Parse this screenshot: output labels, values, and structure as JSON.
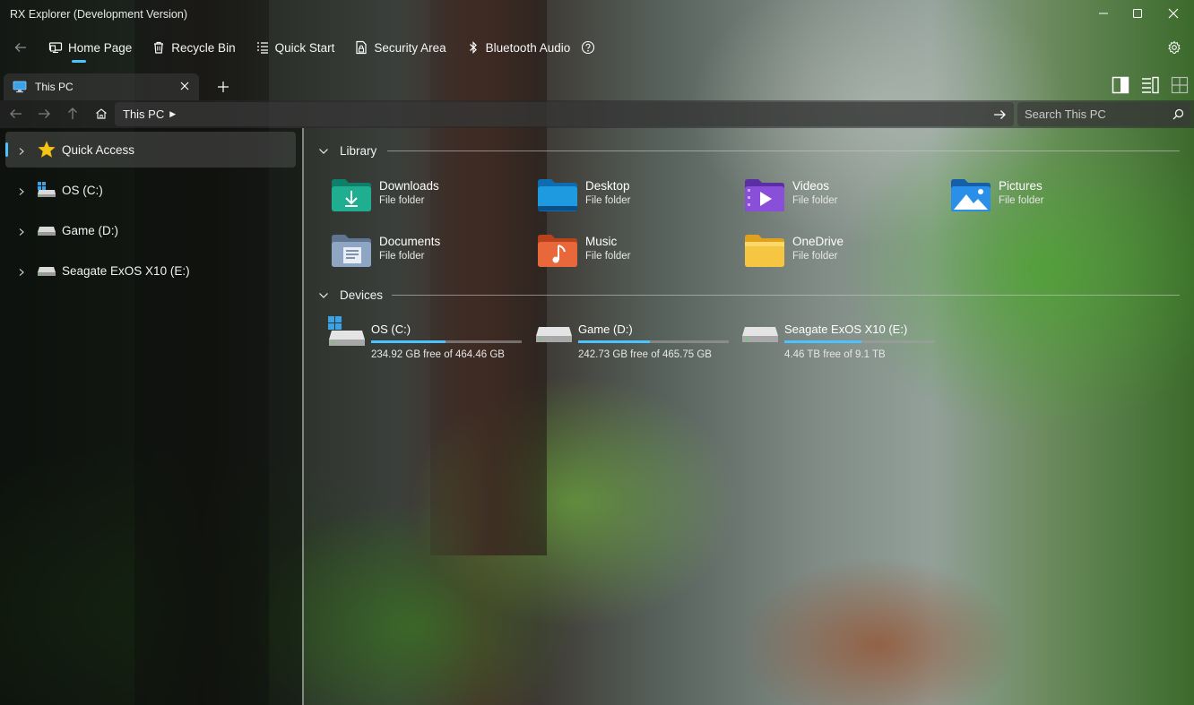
{
  "app": {
    "title": "RX Explorer (Development Version)"
  },
  "nav": {
    "items": [
      {
        "label": "Home Page",
        "icon": "home-page-icon"
      },
      {
        "label": "Recycle Bin",
        "icon": "recycle-bin-icon"
      },
      {
        "label": "Quick Start",
        "icon": "quick-start-icon"
      },
      {
        "label": "Security Area",
        "icon": "security-area-icon"
      },
      {
        "label": "Bluetooth Audio",
        "icon": "bluetooth-icon"
      }
    ]
  },
  "tabs": [
    {
      "label": "This PC",
      "icon": "monitor-icon"
    }
  ],
  "address": {
    "path": "This PC",
    "search_placeholder": "Search This PC"
  },
  "sidebar": {
    "items": [
      {
        "label": "Quick Access",
        "icon": "star-icon"
      },
      {
        "label": "OS (C:)",
        "icon": "windows-drive-icon"
      },
      {
        "label": "Game (D:)",
        "icon": "drive-icon"
      },
      {
        "label": "Seagate ExOS X10 (E:)",
        "icon": "drive-icon"
      }
    ]
  },
  "library": {
    "title": "Library",
    "folders": [
      {
        "name": "Downloads",
        "type": "File folder",
        "color": "#1fae8f"
      },
      {
        "name": "Desktop",
        "type": "File folder",
        "color": "#1e9ae0"
      },
      {
        "name": "Videos",
        "type": "File folder",
        "color": "#8a4fd8"
      },
      {
        "name": "Pictures",
        "type": "File folder",
        "color": "#2a8fe8"
      },
      {
        "name": "Documents",
        "type": "File folder",
        "color": "#8ea6c4"
      },
      {
        "name": "Music",
        "type": "File folder",
        "color": "#e8683c"
      },
      {
        "name": "OneDrive",
        "type": "File folder",
        "color": "#f6c542"
      }
    ]
  },
  "devices": {
    "title": "Devices",
    "items": [
      {
        "name": "OS (C:)",
        "free": "234.92 GB free of 464.46 GB",
        "used_fraction": 0.494
      },
      {
        "name": "Game (D:)",
        "free": "242.73 GB free of 465.75 GB",
        "used_fraction": 0.479
      },
      {
        "name": "Seagate ExOS X10 (E:)",
        "free": "4.46 TB free of 9.1 TB",
        "used_fraction": 0.51
      }
    ]
  },
  "colors": {
    "accent": "#4cc2ff"
  }
}
